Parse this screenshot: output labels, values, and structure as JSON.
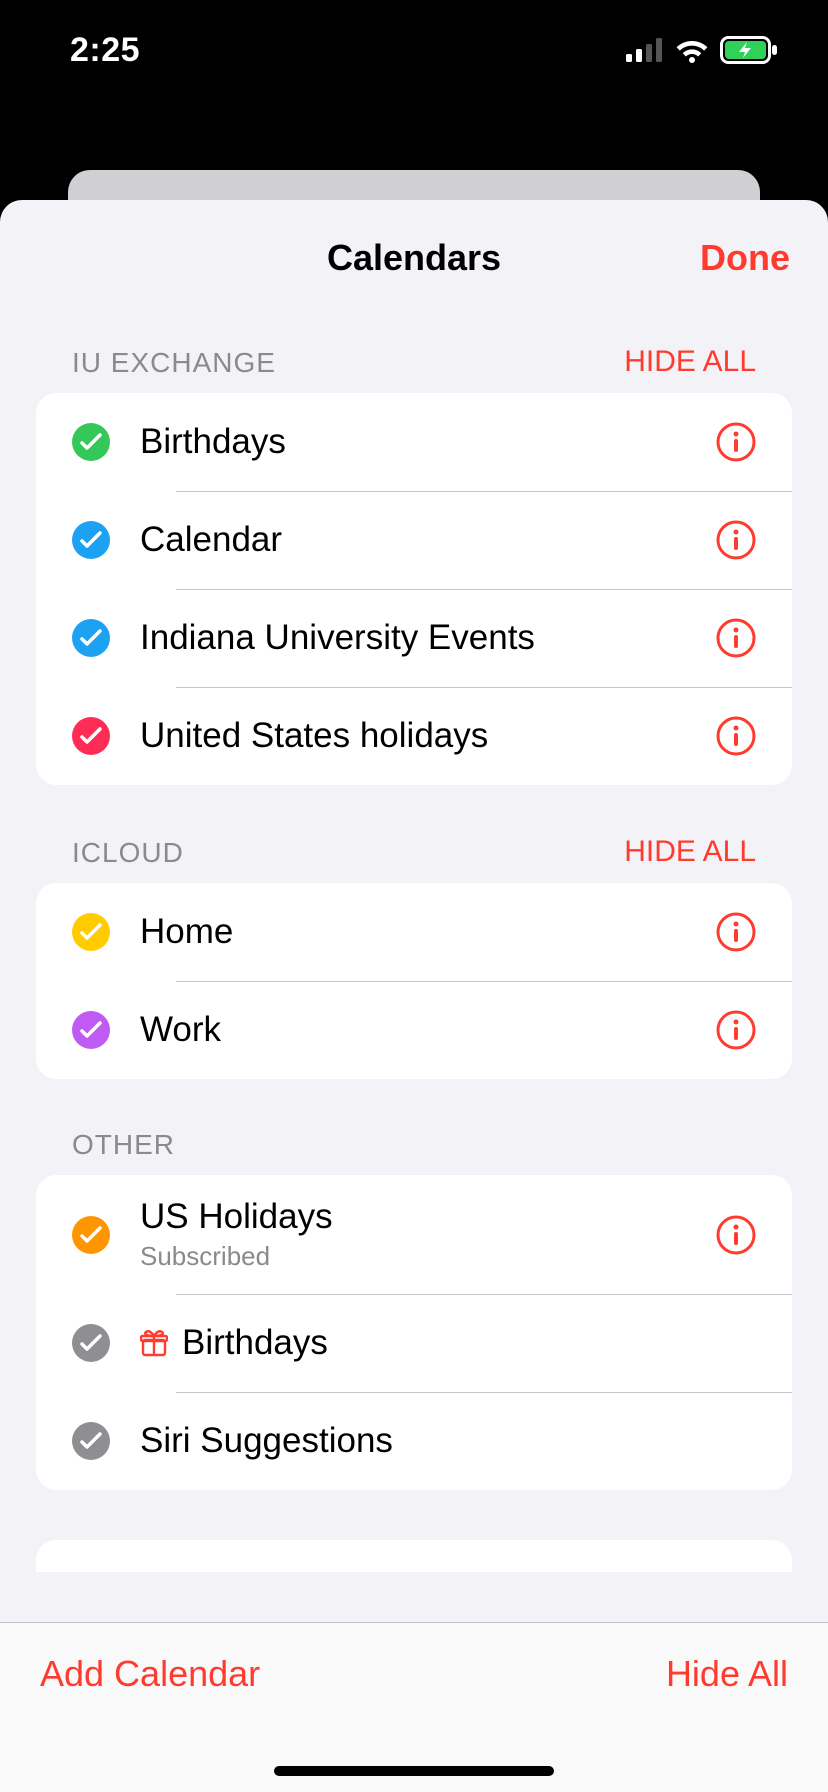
{
  "status": {
    "time": "2:25"
  },
  "header": {
    "title": "Calendars",
    "done": "Done"
  },
  "colors": {
    "accent": "#ff3b30",
    "green": "#34c759",
    "blue": "#1da1f2",
    "pink": "#ff2d55",
    "yellow": "#ffcc00",
    "purple": "#bf5af2",
    "orange": "#ff9500",
    "grey": "#8e8e93"
  },
  "sections": [
    {
      "label": "IU EXCHANGE",
      "hide": "HIDE ALL",
      "items": [
        {
          "name": "Birthdays",
          "color": "green",
          "info": true
        },
        {
          "name": "Calendar",
          "color": "blue",
          "info": true
        },
        {
          "name": "Indiana University Events",
          "color": "blue",
          "info": true
        },
        {
          "name": "United States holidays",
          "color": "pink",
          "info": true
        }
      ]
    },
    {
      "label": "ICLOUD",
      "hide": "HIDE ALL",
      "items": [
        {
          "name": "Home",
          "color": "yellow",
          "info": true
        },
        {
          "name": "Work",
          "color": "purple",
          "info": true
        }
      ]
    },
    {
      "label": "OTHER",
      "hide": "",
      "items": [
        {
          "name": "US Holidays",
          "sub": "Subscribed",
          "color": "orange",
          "info": true
        },
        {
          "name": "Birthdays",
          "icon": "gift",
          "color": "grey",
          "info": false
        },
        {
          "name": "Siri Suggestions",
          "color": "grey",
          "info": false
        }
      ]
    }
  ],
  "toolbar": {
    "add": "Add Calendar",
    "hideAll": "Hide All"
  }
}
